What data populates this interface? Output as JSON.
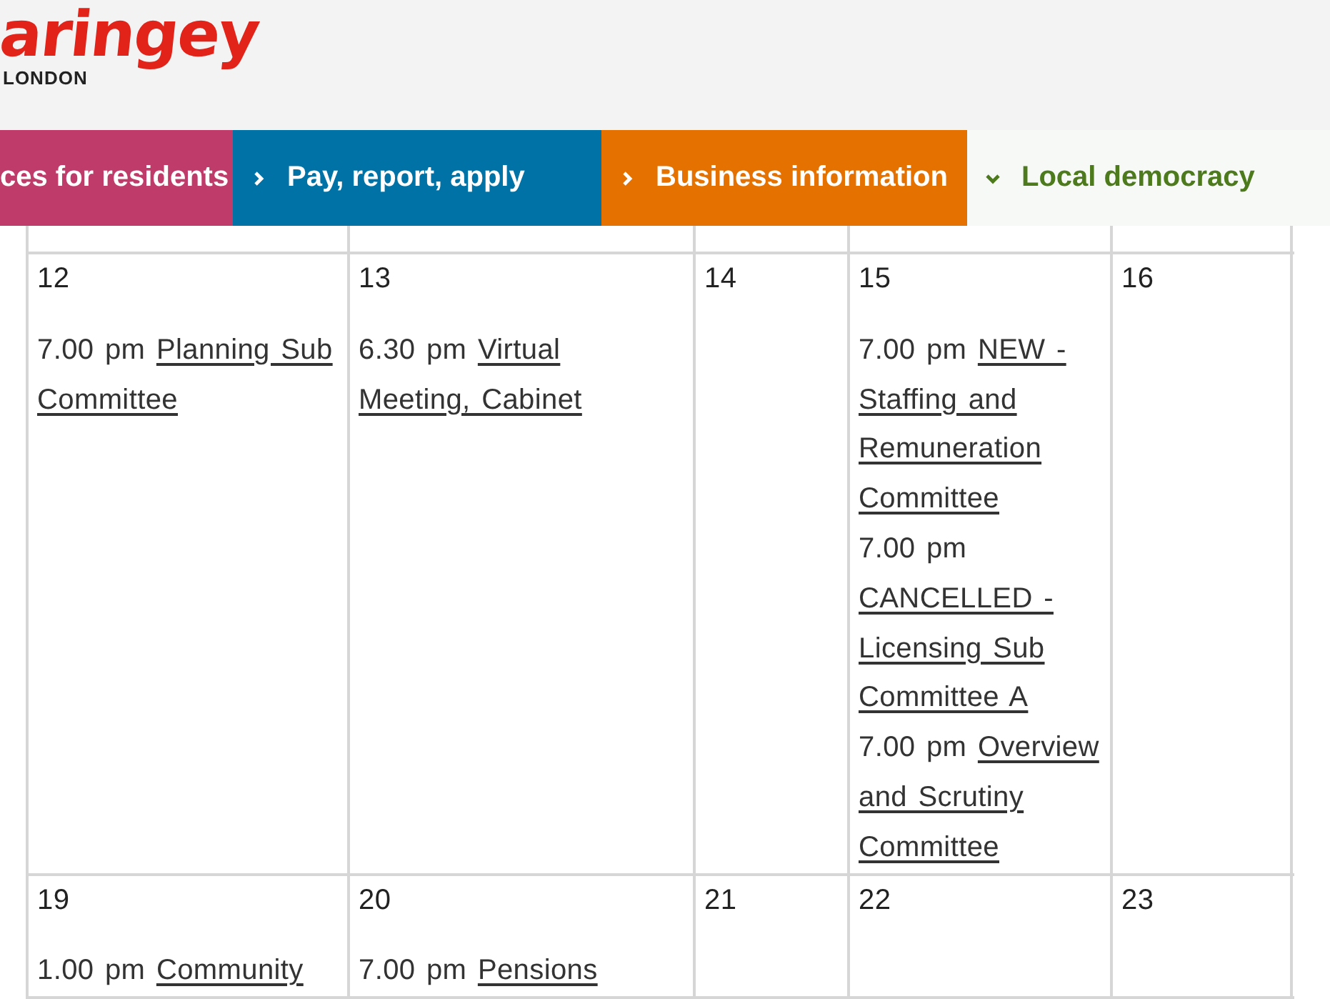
{
  "logo": {
    "name": "aringey",
    "place": "LONDON"
  },
  "nav": [
    {
      "label": "ces for residents",
      "color": "#bf3b6a"
    },
    {
      "label": "Pay, report, apply",
      "color": "#0072a6",
      "expanded": false
    },
    {
      "label": "Business information",
      "color": "#e57200",
      "expanded": false
    },
    {
      "label": "Local democracy",
      "color": "#f7f9f6",
      "expanded": true
    }
  ],
  "weeks": [
    {
      "cells": [
        {
          "day": "12",
          "events": [
            {
              "time": "7.00 pm",
              "title": "Planning Sub Committee"
            }
          ]
        },
        {
          "day": "13",
          "events": [
            {
              "time": "6.30 pm",
              "title": "Virtual Meeting, Cabinet"
            }
          ]
        },
        {
          "day": "14"
        },
        {
          "day": "15",
          "events": [
            {
              "time": "7.00 pm",
              "title": "NEW - Staffing and Remuneration Committee"
            },
            {
              "time": "7.00 pm",
              "title": "CANCELLED - Licensing Sub Committee A"
            },
            {
              "time": "7.00 pm",
              "title": "Overview and Scrutiny Committee"
            }
          ]
        },
        {
          "day": "16"
        }
      ]
    },
    {
      "cells": [
        {
          "day": "19",
          "events": [
            {
              "time": "1.00 pm",
              "title": "Community"
            }
          ]
        },
        {
          "day": "20",
          "events": [
            {
              "time": "7.00 pm",
              "title": "Pensions"
            }
          ]
        },
        {
          "day": "21"
        },
        {
          "day": "22"
        },
        {
          "day": "23"
        }
      ]
    }
  ]
}
